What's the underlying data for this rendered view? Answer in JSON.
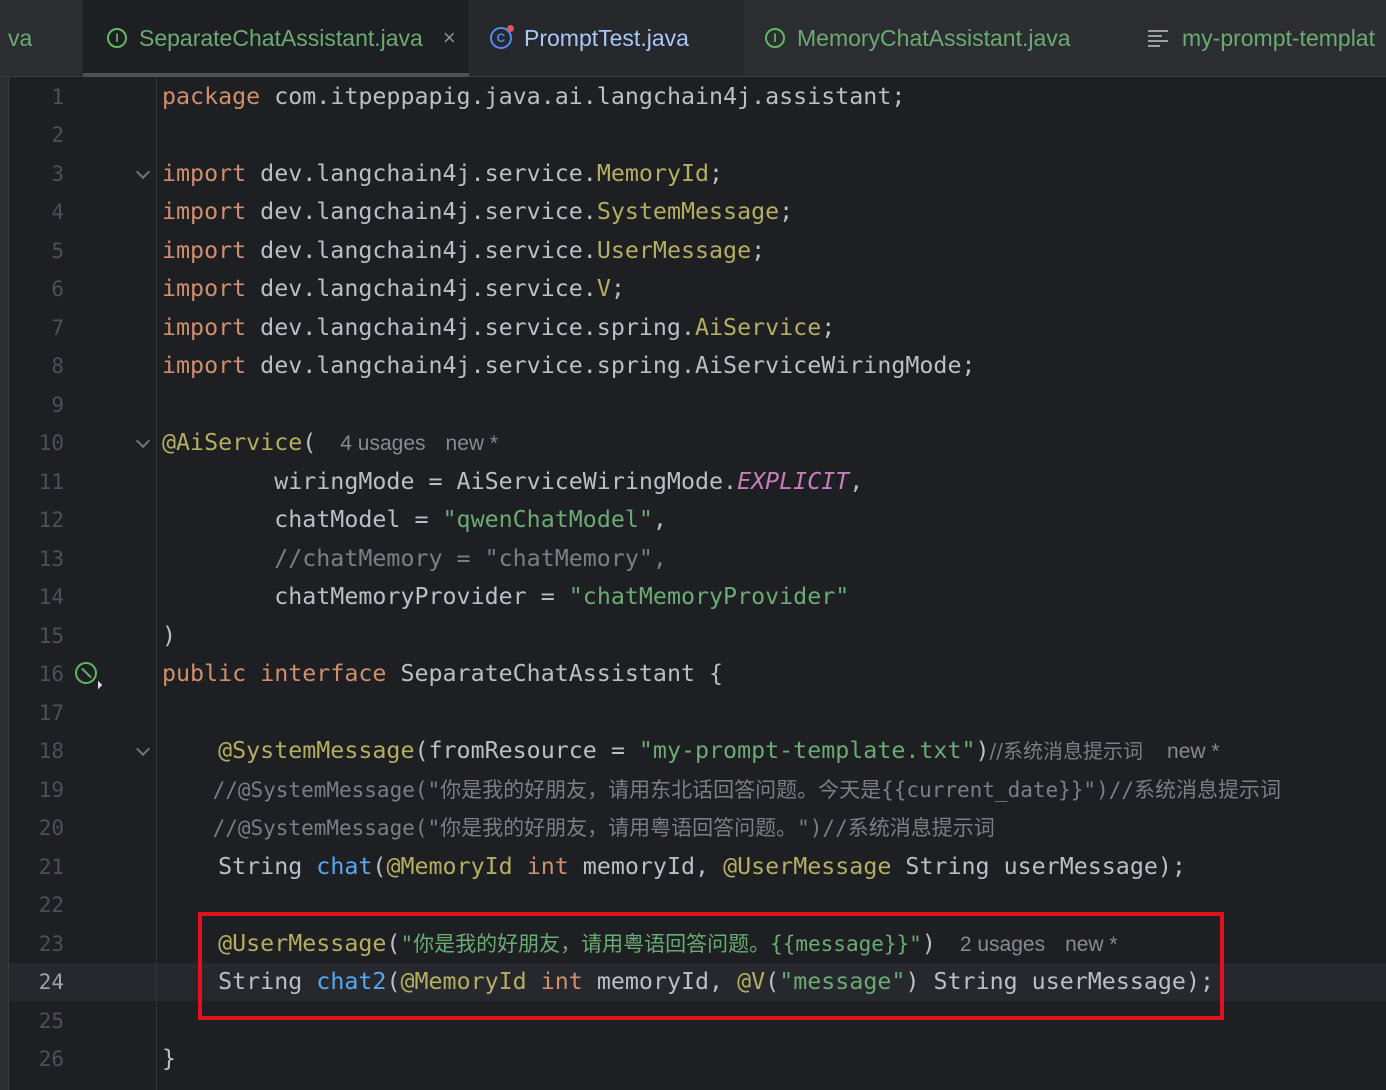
{
  "tabs": [
    {
      "label": "va"
    },
    {
      "label": "SeparateChatAssistant.java",
      "icon": "interface-icon",
      "close": "×"
    },
    {
      "label": "PromptTest.java",
      "icon": "class-icon"
    },
    {
      "label": "MemoryChatAssistant.java",
      "icon": "interface-icon"
    },
    {
      "label": "my-prompt-templat",
      "icon": "text-file-icon"
    }
  ],
  "editor": {
    "current_line": 24,
    "line_numbers": [
      "1",
      "2",
      "3",
      "4",
      "5",
      "6",
      "7",
      "8",
      "9",
      "10",
      "11",
      "12",
      "13",
      "14",
      "15",
      "16",
      "17",
      "18",
      "19",
      "20",
      "21",
      "22",
      "23",
      "24",
      "25",
      "26"
    ],
    "l1": {
      "kw": "package",
      "rest": " com.itpeppapig.java.ai.langchain4j.assistant;"
    },
    "l3": {
      "kw": "import",
      "pkg": " dev.langchain4j.service.",
      "cls": "MemoryId",
      "end": ";"
    },
    "l4": {
      "kw": "import",
      "pkg": " dev.langchain4j.service.",
      "cls": "SystemMessage",
      "end": ";"
    },
    "l5": {
      "kw": "import",
      "pkg": " dev.langchain4j.service.",
      "cls": "UserMessage",
      "end": ";"
    },
    "l6": {
      "kw": "import",
      "pkg": " dev.langchain4j.service.",
      "cls": "V",
      "end": ";"
    },
    "l7": {
      "kw": "import",
      "pkg": " dev.langchain4j.service.spring.",
      "cls": "AiService",
      "end": ";"
    },
    "l8": {
      "kw": "import",
      "rest": " dev.langchain4j.service.spring.AiServiceWiringMode;"
    },
    "l10": {
      "ann": "@AiService",
      "paren": "(",
      "usages": "4 usages",
      "new": "new *"
    },
    "l11": {
      "pre": "        wiringMode = AiServiceWiringMode.",
      "const": "EXPLICIT",
      "end": ","
    },
    "l12": {
      "pre": "        chatModel = ",
      "str": "\"qwenChatModel\"",
      "end": ","
    },
    "l13": {
      "cmt": "        //chatMemory = \"chatMemory\","
    },
    "l14": {
      "pre": "        chatMemoryProvider = ",
      "str": "\"chatMemoryProvider\""
    },
    "l15": {
      "text": ")"
    },
    "l16": {
      "kw1": "public",
      "kw2": "interface",
      "rest": " SeparateChatAssistant {"
    },
    "l18": {
      "ann": "    @SystemMessage",
      "mid": "(fromResource = ",
      "str": "\"my-prompt-template.txt\"",
      "close": ")",
      "cmt": "//系统消息提示词",
      "new": "new *"
    },
    "l19": {
      "cmt": "    //@SystemMessage(\"你是我的好朋友，请用东北话回答问题。今天是{{current_date}}\")//系统消息提示词"
    },
    "l20": {
      "cmt": "    //@SystemMessage(\"你是我的好朋友，请用粤语回答问题。\")//系统消息提示词"
    },
    "l21": {
      "pre": "    String ",
      "fn": "chat",
      "p1": "(",
      "ann1": "@MemoryId",
      "kw": " int",
      "mid": " memoryId, ",
      "ann2": "@UserMessage",
      "end": " String userMessage);"
    },
    "l23": {
      "ann": "    @UserMessage",
      "p1": "(",
      "str": "\"你是我的好朋友，请用粤语回答问题。{{message}}\"",
      "p2": ")",
      "usages": "2 usages",
      "new": "new *"
    },
    "l24": {
      "pre": "    String ",
      "fn": "chat2",
      "p1": "(",
      "ann1": "@MemoryId",
      "kw": " int",
      "mid": " memoryId, ",
      "ann2": "@V",
      "p2": "(",
      "str": "\"message\"",
      "end": ") String userMessage);"
    },
    "l26": {
      "text": "}"
    }
  },
  "colors": {
    "background": "#1e1f22",
    "keyword": "#cf8e6d",
    "annotation": "#b3ae60",
    "string": "#6aab73",
    "comment": "#7a7e85",
    "method": "#56a8f5",
    "constant": "#c77dbb",
    "highlight_box": "#e0121f"
  }
}
